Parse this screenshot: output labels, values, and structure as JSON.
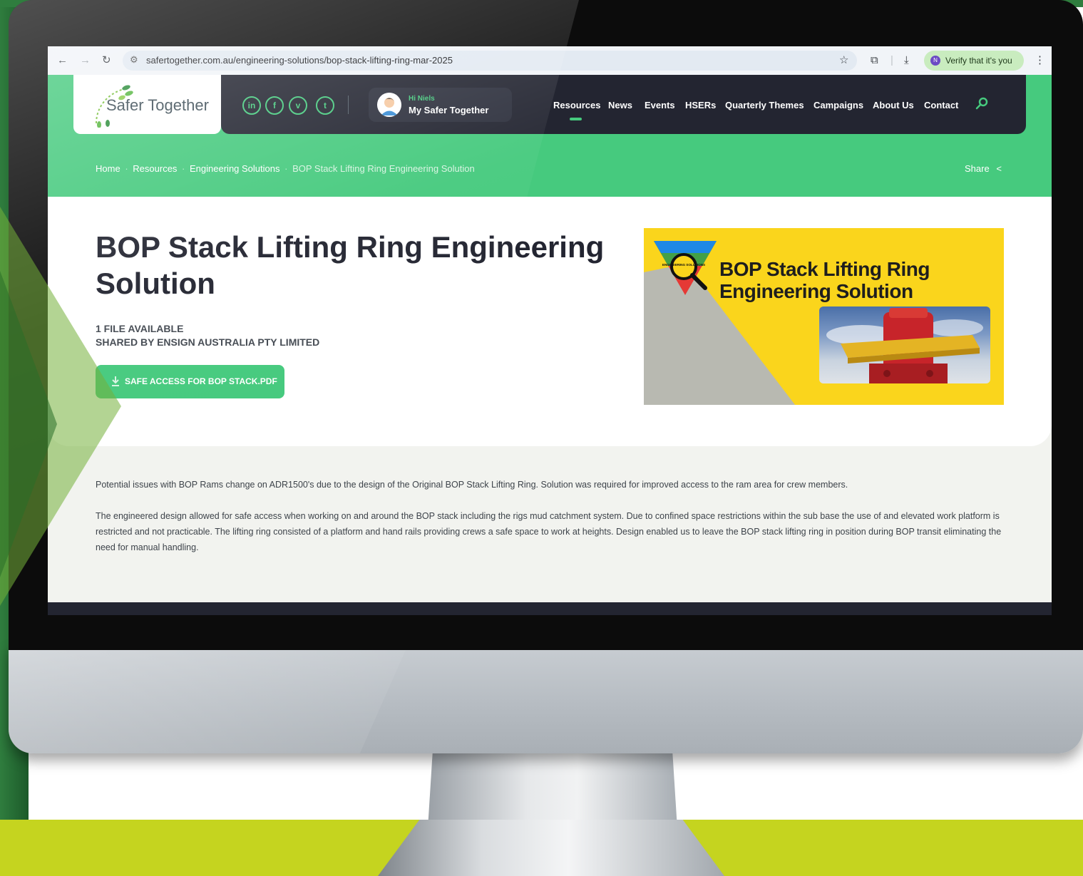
{
  "browser": {
    "url": "safertogether.com.au/engineering-solutions/bop-stack-lifting-ring-mar-2025",
    "verify_label": "Verify that it's you",
    "profile_initial": "N"
  },
  "site": {
    "logo_text": "Safer Together",
    "social": [
      "in",
      "f",
      "v",
      "t"
    ],
    "account": {
      "greeting": "Hi Niels",
      "label": "My Safer Together"
    },
    "nav": [
      "Resources",
      "News",
      "Events",
      "HSERs",
      "Quarterly Themes",
      "Campaigns",
      "About Us",
      "Contact"
    ],
    "active_nav": "Resources"
  },
  "breadcrumb": {
    "items": [
      "Home",
      "Resources",
      "Engineering Solutions"
    ],
    "current": "BOP Stack Lifting Ring Engineering Solution",
    "share_label": "Share"
  },
  "article": {
    "title": "BOP Stack Lifting Ring Engineering Solution",
    "file_count": "1 FILE AVAILABLE",
    "shared_by": "SHARED BY ENSIGN AUSTRALIA PTY LIMITED",
    "download_label": "SAFE ACCESS FOR BOP STACK.PDF",
    "banner_line1": "BOP Stack Lifting Ring",
    "banner_line2": "Engineering Solution",
    "banner_badge": "ENGINEERING SOLUTIONS",
    "paragraphs": [
      "Potential issues with BOP Rams change on ADR1500's due to the design of the Original BOP Stack Lifting Ring. Solution was required for improved access to the ram area for crew members.",
      "The engineered design allowed for safe access when working on and around the BOP stack including the rigs mud catchment system. Due to confined space restrictions within the sub base the use of and elevated work platform is restricted and not practicable. The lifting ring consisted of a platform and hand rails providing crews a safe space to work at heights. Design enabled us to leave the BOP stack lifting ring in position during BOP transit eliminating the need for manual handling."
    ]
  },
  "colors": {
    "brand_green": "#46ca7e",
    "nav_dark": "#232531",
    "banner_yellow": "#fad51c",
    "accent_lime": "#c5d41f"
  }
}
